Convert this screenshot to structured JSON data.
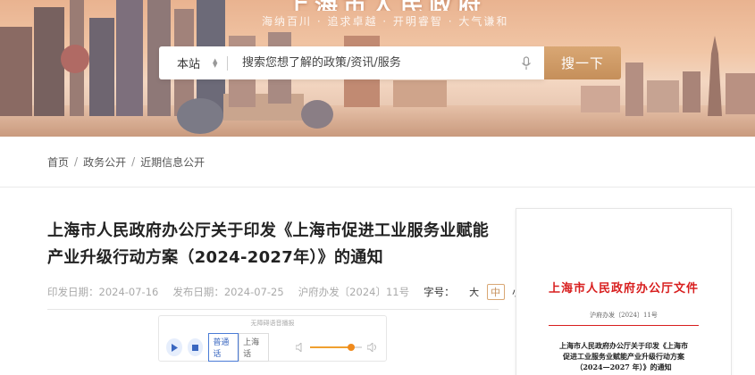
{
  "header": {
    "site_title": "上海市人民政府",
    "slogan": "海纳百川 · 追求卓越 · 开明睿智 · 大气谦和"
  },
  "search": {
    "scope_label": "本站",
    "placeholder": "搜索您想了解的政策/资讯/服务",
    "button_label": "搜一下"
  },
  "breadcrumb": {
    "items": [
      "首页",
      "政务公开",
      "近期信息公开"
    ],
    "separator": "/"
  },
  "article": {
    "title": "上海市人民政府办公厅关于印发《上海市促进工业服务业赋能产业升级行动方案（2024-2027年）》的通知",
    "print_date": "印发日期：2024-07-16",
    "publish_date": "发布日期：2024-07-25",
    "doc_number": "沪府办发〔2024〕11号",
    "font_size_label": "字号：",
    "font_sizes": [
      "大",
      "中",
      "小"
    ],
    "font_size_selected": "中"
  },
  "player": {
    "caption": "无障碍语音播报",
    "languages": [
      "普通话",
      "上海话"
    ],
    "selected_language": "普通话",
    "volume": 0.78
  },
  "document_preview": {
    "header": "上海市人民政府办公厅文件",
    "number": "沪府办发〔2024〕11号",
    "title_lines": [
      "上海市人民政府办公厅关于印发《上海市",
      "促进工业服务业赋能产业升级行动方案",
      "（2024—2027 年）》的通知"
    ]
  },
  "colors": {
    "accent": "#c58f5a",
    "doc_red": "#d81e1e"
  }
}
